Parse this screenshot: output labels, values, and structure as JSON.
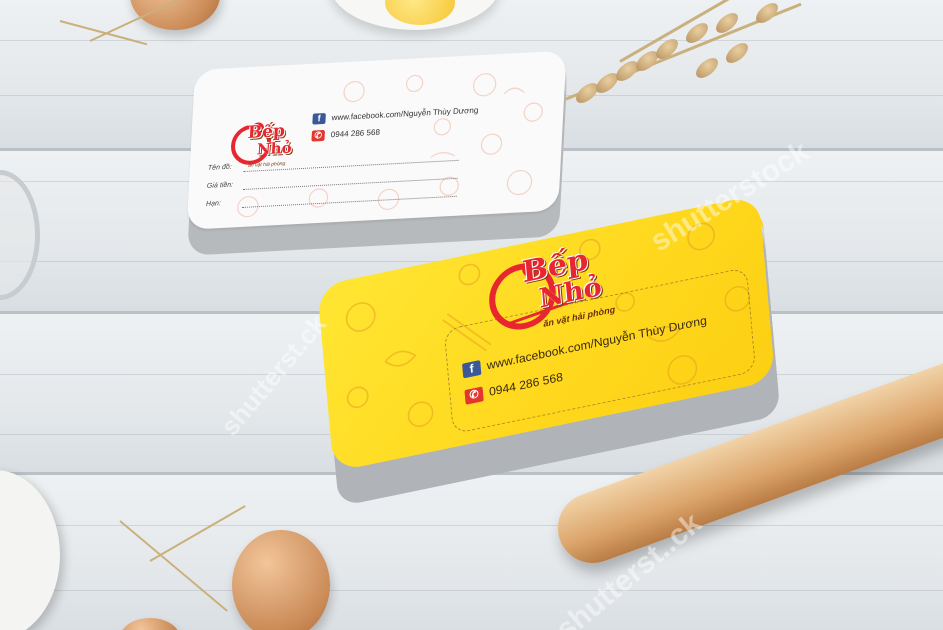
{
  "cards": {
    "logo_line1": "Bếp",
    "logo_line2": "Nhỏ",
    "tagline": "ăn vặt hải phòng",
    "facebook": "www.facebook.com/Nguyễn Thùy Dương",
    "phone": "0944 286 568",
    "fields": [
      "Tên đồ:",
      "Giá tiền:",
      "Hạn:"
    ]
  },
  "watermark": [
    "shutterstock",
    "shutterst.ck",
    "shutterst..ck"
  ],
  "icons": {
    "facebook": "facebook-icon",
    "phone": "phone-icon"
  },
  "colors": {
    "card_yellow": "#ffd91f",
    "logo_red": "#e8262f",
    "facebook_blue": "#3b5998",
    "phone_red": "#e5362e"
  }
}
